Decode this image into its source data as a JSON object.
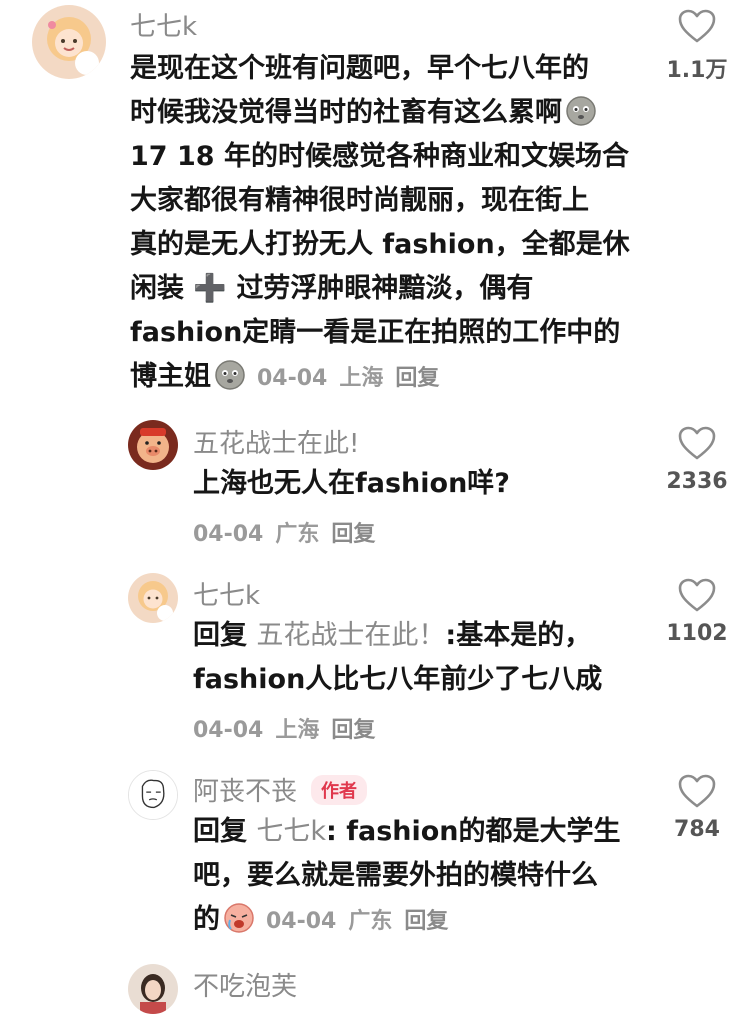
{
  "comments": [
    {
      "username": "七七k",
      "lines": [
        "是现在这个班有问题吧，早个七八年的",
        "时候我没觉得当时的社畜有这么累啊",
        "17 18 年的时候感觉各种商业和文娱场合",
        "大家都很有精神很时尚靓丽，现在街上",
        "真的是无人打扮无人 fashion，全都是休",
        "闲装",
        "过劳浮肿眼神黯淡，偶有",
        "fashion定睛一看是正在拍照的工作中的",
        "博主姐"
      ],
      "plus_symbol": "➕",
      "date": "04-04",
      "location": "上海",
      "reply_label": "回复",
      "likes": "1.1万"
    },
    {
      "username": "五花战士在此!",
      "lines": [
        "上海也无人在fashion咩?"
      ],
      "date": "04-04",
      "location": "广东",
      "reply_label": "回复",
      "likes": "2336"
    },
    {
      "username": "七七k",
      "reply_prefix": "回复",
      "reply_target": "五花战士在此！",
      "lines": [
        ":基本是的，",
        "fashion人比七八年前少了七八成"
      ],
      "date": "04-04",
      "location": "上海",
      "reply_label": "回复",
      "likes": "1102"
    },
    {
      "username": "阿丧不丧",
      "badge": "作者",
      "reply_prefix": "回复",
      "reply_target": "七七k",
      "lines": [
        ": fashion的都是大学生",
        "吧，要么就是需要外拍的模特什么",
        "的"
      ],
      "date": "04-04",
      "location": "广东",
      "reply_label": "回复",
      "likes": "784"
    },
    {
      "username": "不吃泡芙"
    }
  ],
  "icons": {
    "heart": "heart-outline-icon",
    "emoji_sad": "sad-face-emoji",
    "emoji_cry": "crying-face-emoji"
  },
  "colors": {
    "username": "#8a8a8a",
    "text": "#161616",
    "meta": "#9a9a9a",
    "badge_text": "#e0384d",
    "badge_bg": "#fde9ec"
  }
}
